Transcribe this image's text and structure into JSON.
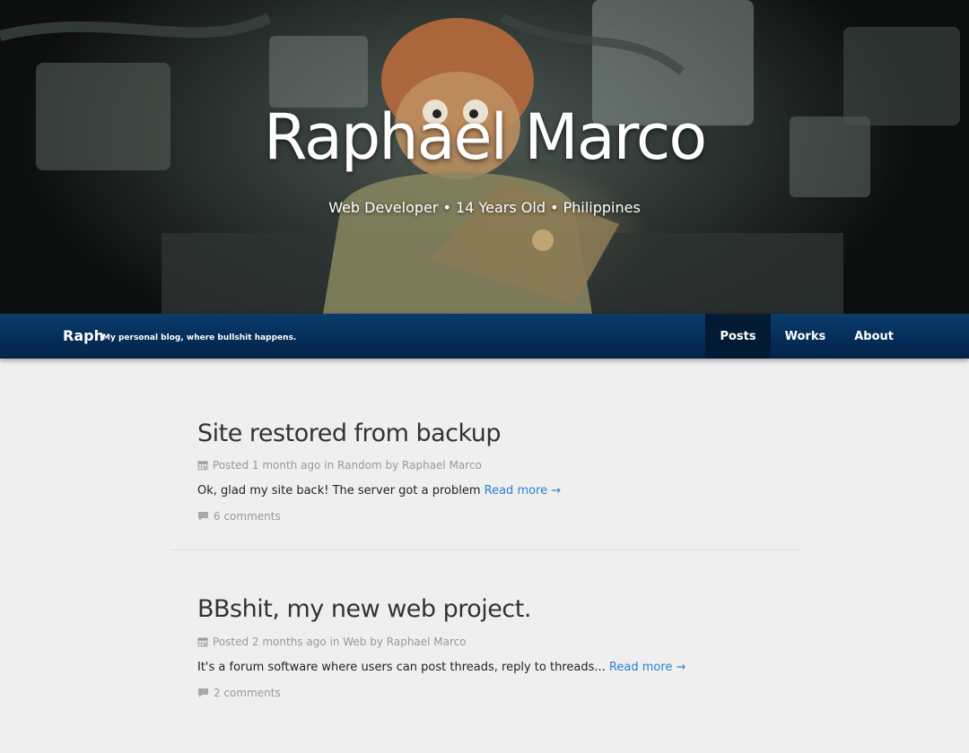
{
  "hero": {
    "title": "Raphael Marco",
    "subtitle": "Web Developer • 14 Years Old • Philippines"
  },
  "navbar": {
    "brand": "Raph",
    "tagline": "My personal blog, where bullshit happens.",
    "links": [
      {
        "label": "Posts",
        "active": true
      },
      {
        "label": "Works",
        "active": false
      },
      {
        "label": "About",
        "active": false
      }
    ]
  },
  "posts": [
    {
      "title": "Site restored from backup",
      "meta": "Posted 1 month ago in Random by Raphael Marco",
      "excerpt": "Ok, glad my site back! The server got a problem",
      "read_more": "Read more →",
      "comments": "6 comments"
    },
    {
      "title": "BBshit, my new web project.",
      "meta": "Posted 2 months ago in Web by Raphael Marco",
      "excerpt": "It's a forum software where users can post threads, reply to threads...",
      "read_more": "Read more →",
      "comments": "2 comments"
    }
  ],
  "colors": {
    "navbar": "#042c57",
    "nav_active": "#021a33",
    "link": "#2a7fd4",
    "page_bg": "#efefef",
    "meta_text": "#999999"
  },
  "icons": {
    "meta": "calendar-icon",
    "comments": "comment-icon"
  }
}
